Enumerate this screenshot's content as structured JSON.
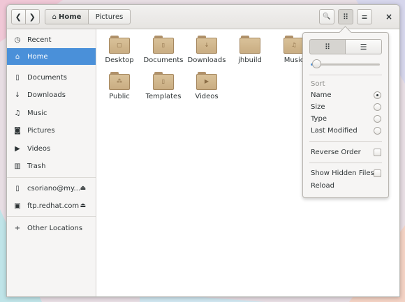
{
  "nav": {
    "back_icon": "chevron-left-icon",
    "forward_icon": "chevron-right-icon",
    "back_glyph": "❮",
    "forward_glyph": "❯"
  },
  "pathbar": {
    "home_icon": "home-icon",
    "home_glyph": "⌂",
    "home_label": "Home",
    "second_label": "Pictures"
  },
  "toolbar": {
    "search_glyph": "🔍",
    "grid_glyph": "⠿",
    "menu_glyph": "≡",
    "close_glyph": "×"
  },
  "sidebar": {
    "items": [
      {
        "label": "Recent",
        "glyph": "◷"
      },
      {
        "label": "Home",
        "glyph": "⌂"
      },
      {
        "label": "Documents",
        "glyph": "▯"
      },
      {
        "label": "Downloads",
        "glyph": "↓"
      },
      {
        "label": "Music",
        "glyph": "♫"
      },
      {
        "label": "Pictures",
        "glyph": "◙"
      },
      {
        "label": "Videos",
        "glyph": "▶"
      },
      {
        "label": "Trash",
        "glyph": "▥"
      },
      {
        "label": "csoriano@my...",
        "glyph": "▯",
        "eject": "⏏"
      },
      {
        "label": "ftp.redhat.com",
        "glyph": "▣",
        "eject": "⏏"
      },
      {
        "label": "Other Locations",
        "glyph": "+"
      }
    ]
  },
  "files": [
    {
      "label": "Desktop",
      "emblem": "▢"
    },
    {
      "label": "Documents",
      "emblem": "▯"
    },
    {
      "label": "Downloads",
      "emblem": "↓"
    },
    {
      "label": "jhbuild",
      "emblem": ""
    },
    {
      "label": "Music",
      "emblem": "♫"
    },
    {
      "label": "Public",
      "emblem": "⁂"
    },
    {
      "label": "Templates",
      "emblem": "▯"
    },
    {
      "label": "Videos",
      "emblem": "▶"
    }
  ],
  "popover": {
    "grid_glyph": "⠿",
    "list_glyph": "☰",
    "zoom_level": 0.08,
    "sort_label": "Sort",
    "sort_options": [
      "Name",
      "Size",
      "Type",
      "Last Modified"
    ],
    "sort_selected": "Name",
    "reverse_label": "Reverse Order",
    "reverse_checked": false,
    "hidden_label": "Show Hidden Files",
    "hidden_checked": false,
    "reload_label": "Reload"
  },
  "colors": {
    "accent": "#4a90d9",
    "folder": "#d3b68b"
  }
}
